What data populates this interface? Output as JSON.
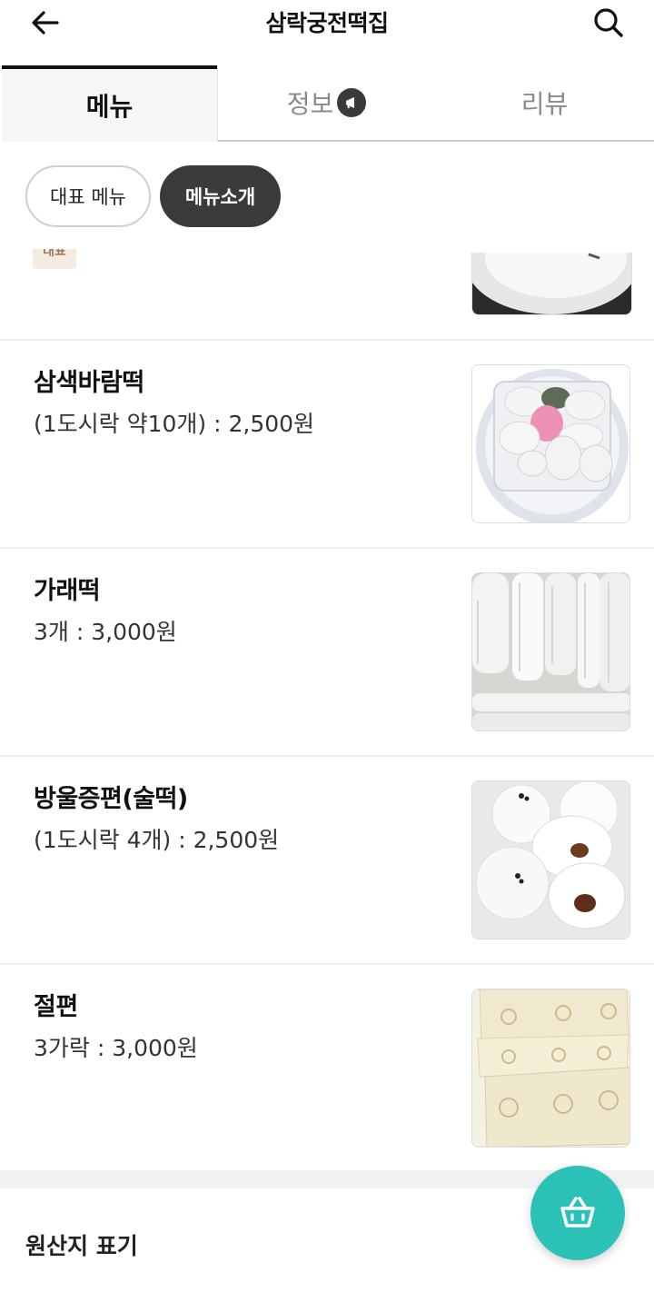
{
  "header": {
    "title": "삼락궁전떡집"
  },
  "tabs": [
    {
      "label": "메뉴"
    },
    {
      "label": "정보"
    },
    {
      "label": "리뷰"
    }
  ],
  "chips": [
    {
      "label": "대표 메뉴"
    },
    {
      "label": "메뉴소개"
    }
  ],
  "partial_item": {
    "tag": "대표"
  },
  "menu_items": [
    {
      "name": "삼색바람떡",
      "price": "(1도시락 약10개) : 2,500원"
    },
    {
      "name": "가래떡",
      "price": "3개 : 3,000원"
    },
    {
      "name": "방울증편(술떡)",
      "price": "(1도시락 4개) : 2,500원"
    },
    {
      "name": "절편",
      "price": "3가락 : 3,000원"
    }
  ],
  "origin_section": {
    "title": "원산지 표기"
  },
  "colors": {
    "fab": "#2bc1b6",
    "active_chip": "#3b3b3b",
    "tag_bg": "#f4ebe2"
  }
}
